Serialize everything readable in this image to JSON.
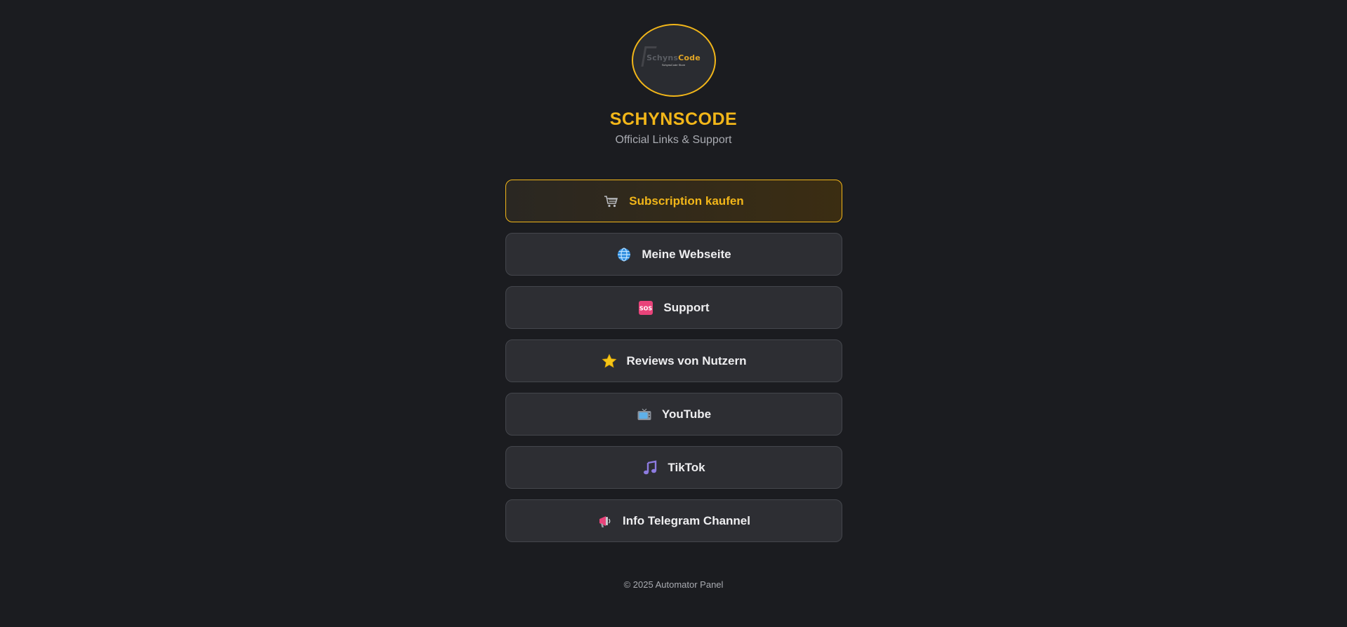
{
  "header": {
    "logo": {
      "wordmark_part1": "Schyns",
      "wordmark_part2": "Code",
      "tagline": "SchynsCode Store"
    },
    "title": "SCHYNSCODE",
    "subtitle": "Official Links & Support"
  },
  "links": [
    {
      "label": "Subscription kaufen",
      "icon": "shopping-cart-icon"
    },
    {
      "label": "Meine Webseite",
      "icon": "globe-icon"
    },
    {
      "label": "Support",
      "icon": "sos-icon"
    },
    {
      "label": "Reviews von Nutzern",
      "icon": "star-icon"
    },
    {
      "label": "YouTube",
      "icon": "television-icon"
    },
    {
      "label": "TikTok",
      "icon": "music-note-icon"
    },
    {
      "label": "Info Telegram Channel",
      "icon": "megaphone-icon"
    }
  ],
  "footer": {
    "text": "© 2025 Automator Panel"
  },
  "colors": {
    "background": "#1b1c20",
    "accent": "#f2b619",
    "button_bg": "#2d2e33",
    "text": "#eeeef0",
    "muted": "#a9abb1"
  }
}
